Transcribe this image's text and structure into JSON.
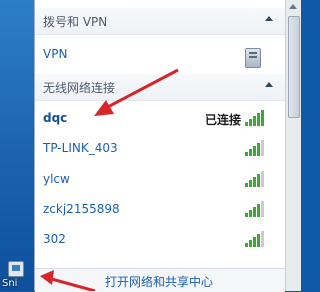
{
  "desktop": {
    "icon_label": "Sni"
  },
  "vpn_group": {
    "title": "拨号和 VPN",
    "items": [
      {
        "name": "VPN"
      }
    ]
  },
  "wireless_group": {
    "title": "无线网络连接",
    "networks": [
      {
        "name": "dqc",
        "status": "已连接",
        "signal": "full"
      },
      {
        "name": "TP-LINK_403",
        "signal": "weak"
      },
      {
        "name": "ylcw",
        "signal": "weak"
      },
      {
        "name": "zckj2155898",
        "signal": "weak"
      },
      {
        "name": "302",
        "signal": "weak"
      }
    ]
  },
  "footer": {
    "link": "打开网络和共享中心"
  },
  "colors": {
    "link": "#1a5fb4",
    "annotation": "#d7262b",
    "signal": "#3fa63a"
  }
}
